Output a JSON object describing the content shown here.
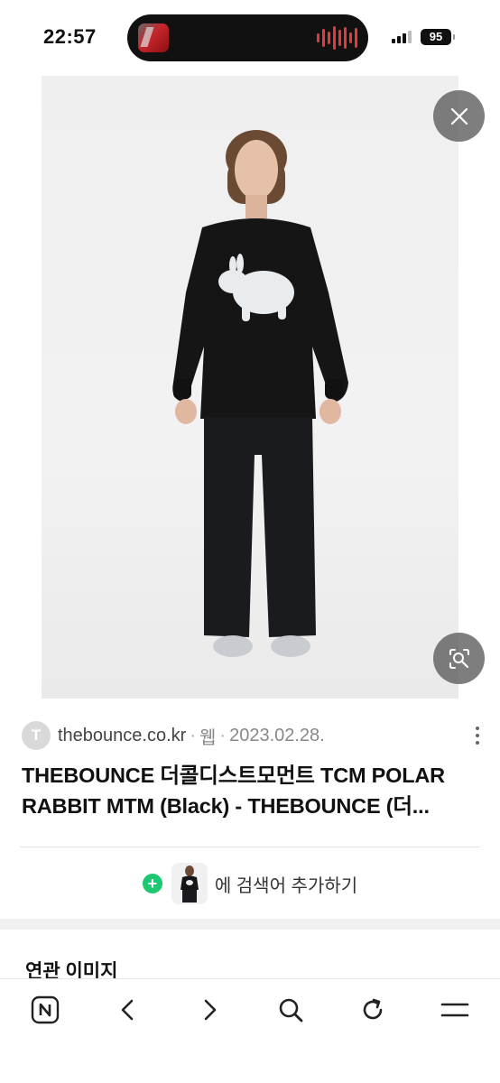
{
  "status_bar": {
    "time": "22:57",
    "battery": "95"
  },
  "photo": {
    "description_icon_close": "close-icon",
    "description_icon_lens": "image-search-icon"
  },
  "result": {
    "source_initial": "T",
    "source_domain": "thebounce.co.kr",
    "separator": "·",
    "source_type": "웹",
    "source_date": "2023.02.28.",
    "title_line1": "THEBOUNCE 더콜디스트모먼트 TCM POLAR",
    "title_line2": "RABBIT MTM (Black) - THEBOUNCE (더..."
  },
  "add_search": {
    "label": "에 검색어 추가하기"
  },
  "related": {
    "title": "연관 이미지"
  },
  "colors": {
    "accent_green": "#1ec873",
    "overlay_button": "#5a5a5a"
  }
}
